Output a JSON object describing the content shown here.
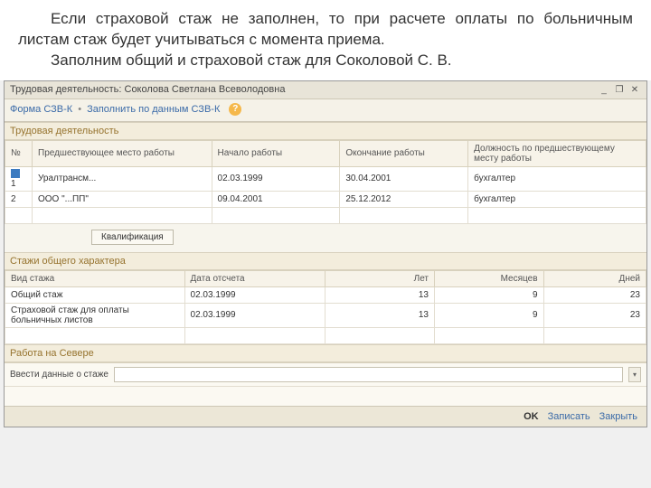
{
  "intro": {
    "p1": "Если страховой стаж не заполнен, то при расчете оплаты по больничным листам стаж будет учитываться с момента приема.",
    "p2": "Заполним общий и страховой стаж для Соколовой С. В."
  },
  "window": {
    "title": "Трудовая деятельность: Соколова Светлана Всеволодовна"
  },
  "toolbar": {
    "form": "Форма СЗВ-К",
    "fill": "Заполнить по данным СЗВ-К",
    "sep": "•",
    "help": "?"
  },
  "sec1": {
    "title": "Трудовая деятельность",
    "headers": {
      "num": "№",
      "prev": "Предшествующее место работы",
      "start": "Начало работы",
      "end": "Окончание работы",
      "pos": "Должность по предшествующему месту работы"
    },
    "rows": [
      {
        "num": "1",
        "place": "Уралтрансм...",
        "start": "02.03.1999",
        "end": "30.04.2001",
        "pos": "бухгалтер"
      },
      {
        "num": "2",
        "place": "ООО \"...ПП\"",
        "start": "09.04.2001",
        "end": "25.12.2012",
        "pos": "бухгалтер"
      }
    ],
    "qual": "Квалификация"
  },
  "sec2": {
    "title": "Стажи общего характера",
    "headers": {
      "kind": "Вид стажа",
      "date": "Дата отсчета",
      "years": "Лет",
      "months": "Месяцев",
      "days": "Дней"
    },
    "rows": [
      {
        "kind": "Общий стаж",
        "date": "02.03.1999",
        "years": "13",
        "months": "9",
        "days": "23"
      },
      {
        "kind": "Страховой стаж для оплаты больничных листов",
        "date": "02.03.1999",
        "years": "13",
        "months": "9",
        "days": "23"
      }
    ]
  },
  "sec3": {
    "title": "Работа на Севере",
    "label": "Ввести данные о стаже"
  },
  "footer": {
    "ok": "OK",
    "save": "Записать",
    "close": "Закрыть"
  }
}
